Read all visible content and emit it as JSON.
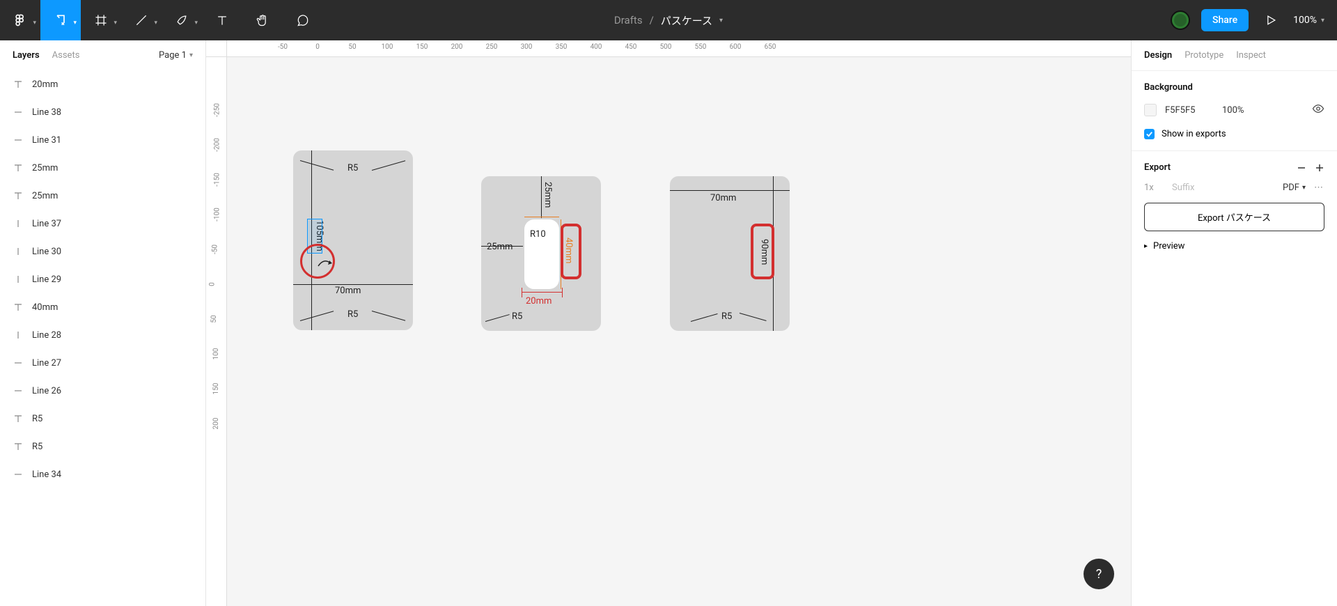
{
  "toolbar": {
    "drafts_label": "Drafts",
    "separator": "/",
    "file_name": "パスケース",
    "share_label": "Share",
    "zoom": "100%"
  },
  "left_panel": {
    "tabs": {
      "layers": "Layers",
      "assets": "Assets"
    },
    "page_selector": "Page 1",
    "layers": [
      {
        "type": "text",
        "name": "20mm"
      },
      {
        "type": "line",
        "name": "Line 38"
      },
      {
        "type": "line",
        "name": "Line 31"
      },
      {
        "type": "text",
        "name": "25mm"
      },
      {
        "type": "text",
        "name": "25mm"
      },
      {
        "type": "vline",
        "name": "Line 37"
      },
      {
        "type": "vline",
        "name": "Line 30"
      },
      {
        "type": "vline",
        "name": "Line 29"
      },
      {
        "type": "text",
        "name": "40mm"
      },
      {
        "type": "vline",
        "name": "Line 28"
      },
      {
        "type": "line",
        "name": "Line 27"
      },
      {
        "type": "line",
        "name": "Line 26"
      },
      {
        "type": "text",
        "name": "R5"
      },
      {
        "type": "text",
        "name": "R5"
      },
      {
        "type": "line",
        "name": "Line 34"
      }
    ]
  },
  "right_panel": {
    "tabs": {
      "design": "Design",
      "prototype": "Prototype",
      "inspect": "Inspect"
    },
    "background": {
      "title": "Background",
      "hex": "F5F5F5",
      "opacity": "100%",
      "show_in_exports": "Show in exports"
    },
    "export": {
      "title": "Export",
      "scale": "1x",
      "suffix_placeholder": "Suffix",
      "format": "PDF",
      "button_label": "Export パスケース",
      "preview_label": "Preview"
    }
  },
  "ruler_h": [
    "-50",
    "0",
    "50",
    "100",
    "150",
    "200",
    "250",
    "300",
    "350",
    "400",
    "450",
    "500",
    "550",
    "600",
    "650"
  ],
  "ruler_v": [
    "-250",
    "-200",
    "-150",
    "-100",
    "-50",
    "0",
    "50",
    "100",
    "150",
    "200"
  ],
  "canvas": {
    "ab1": {
      "r5_top": "R5",
      "r5_bot": "R5",
      "w70": "70mm",
      "h105": "105mm"
    },
    "ab2": {
      "r5": "R5",
      "r10": "R10",
      "w25_left": "25mm",
      "h25_top": "25mm",
      "h40": "40mm",
      "w20": "20mm"
    },
    "ab3": {
      "r5": "R5",
      "w70": "70mm",
      "h90": "90mm"
    }
  },
  "help": "?"
}
